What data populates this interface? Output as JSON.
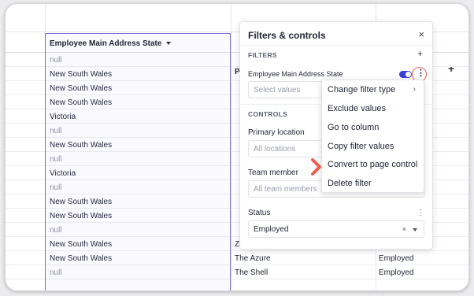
{
  "table": {
    "selected_column_header": "Employee Main Address State",
    "second_column_header_partial": "P",
    "add_column_label": "+",
    "rows": [
      {
        "state": "null",
        "name": "",
        "status": ""
      },
      {
        "state": "New South Wales",
        "name": "",
        "status": ""
      },
      {
        "state": "New South Wales",
        "name": "",
        "status": ""
      },
      {
        "state": "New South Wales",
        "name": "",
        "status": ""
      },
      {
        "state": "Victoria",
        "name": "",
        "status": ""
      },
      {
        "state": "null",
        "name": "",
        "status": ""
      },
      {
        "state": "New South Wales",
        "name": "",
        "status": ""
      },
      {
        "state": "null",
        "name": "",
        "status": ""
      },
      {
        "state": "Victoria",
        "name": "",
        "status": ""
      },
      {
        "state": "null",
        "name": "",
        "status": ""
      },
      {
        "state": "New South Wales",
        "name": "",
        "status": ""
      },
      {
        "state": "New South Wales",
        "name": "",
        "status": ""
      },
      {
        "state": "null",
        "name": "",
        "status": ""
      },
      {
        "state": "New South Wales",
        "name": "Ze Coco's George St Cafe",
        "status": "Employed"
      },
      {
        "state": "New South Wales",
        "name": "The Azure",
        "status": "Employed"
      },
      {
        "state": "null",
        "name": "The Shell",
        "status": "Employed"
      }
    ]
  },
  "panel": {
    "title": "Filters & controls",
    "close_icon": "×",
    "filters_label": "FILTERS",
    "filters_add": "+",
    "filter_name": "Employee Main Address State",
    "filter_placeholder": "Select values",
    "kebab_glyph": "⋮",
    "controls_label": "CONTROLS",
    "primary_location_label": "Primary location",
    "primary_location_placeholder": "All locations",
    "team_member_label": "Team member",
    "team_member_placeholder": "All team members",
    "status_label": "Status",
    "status_value": "Employed",
    "status_clear": "×",
    "kebab_small": "⋮"
  },
  "menu": {
    "items": [
      "Change filter type",
      "Exclude values",
      "Go to column",
      "Copy filter values",
      "Convert to page control",
      "Delete filter"
    ],
    "submenu_arrow": "›"
  },
  "colors": {
    "accent": "#3b3fd8",
    "selection": "#7c6cd9",
    "highlight": "#ef5b4f"
  }
}
